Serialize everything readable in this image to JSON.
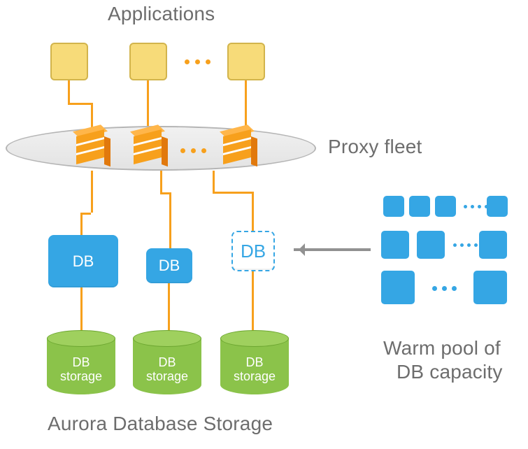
{
  "labels": {
    "applications": "Applications",
    "proxy_fleet": "Proxy fleet",
    "aurora_storage": "Aurora Database Storage",
    "warm_pool_l1": "Warm pool of",
    "warm_pool_l2": "DB capacity"
  },
  "db": {
    "large": "DB",
    "medium": "DB",
    "dashed": "DB"
  },
  "storage": {
    "s1_l1": "DB",
    "s1_l2": "storage",
    "s2_l1": "DB",
    "s2_l2": "storage",
    "s3_l1": "DB",
    "s3_l2": "storage"
  },
  "colors": {
    "aws_orange": "#f7a01c",
    "app_fill": "#f7db79",
    "blue": "#35a6e4",
    "green": "#8bc34a",
    "gray_text": "#6d6d6d",
    "arrow": "#919191"
  }
}
